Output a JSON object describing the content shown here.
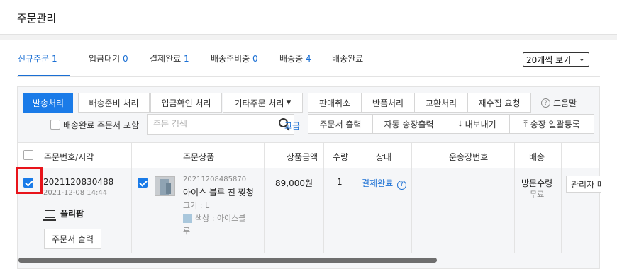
{
  "header": {
    "title": "주문관리"
  },
  "status_tabs": [
    {
      "label": "신규주문",
      "count": "1"
    },
    {
      "label": "입금대기",
      "count": "0"
    },
    {
      "label": "결제완료",
      "count": "1"
    },
    {
      "label": "배송준비중",
      "count": "0"
    },
    {
      "label": "배송중",
      "count": "4"
    },
    {
      "label": "배송완료",
      "count": ""
    }
  ],
  "per_page": {
    "value": "20개씩 보기"
  },
  "toolbar": {
    "ship": "발송처리",
    "prep": "배송준비 처리",
    "deposit": "입금확인 처리",
    "other": "기타주문 처리",
    "cancel": "판매취소",
    "return": "반품처리",
    "exchange": "교환처리",
    "recollect": "재수집 요청",
    "help": "도움말"
  },
  "filters": {
    "include_done_label": "배송완료 주문서 포함",
    "search_placeholder": "주문 검색",
    "advanced": "고급",
    "print_order": "주문서 출력",
    "auto_invoice": "자동 송장출력",
    "export": "내보내기",
    "bulk_invoice": "송장 일괄등록"
  },
  "table": {
    "headers": [
      "주문번호/시각",
      "주문상품",
      "상품금액",
      "수량",
      "상태",
      "운송장번호",
      "배송"
    ],
    "row": {
      "order_no": "2021120830488",
      "order_time": "2021-12-08 14:44",
      "channel": "플리팝",
      "print_btn": "주문서 출력",
      "product_code": "20211208485870",
      "product_name": "아이스 블루 진 찢청",
      "size": "크기 : L",
      "color_line1": "색상 : 아이스블",
      "color_line2": "루",
      "price": "89,000원",
      "qty": "1",
      "status": "결제완료",
      "delivery_method": "방문수령",
      "delivery_fee": "무료",
      "admin_btn": "관리자 메"
    }
  }
}
